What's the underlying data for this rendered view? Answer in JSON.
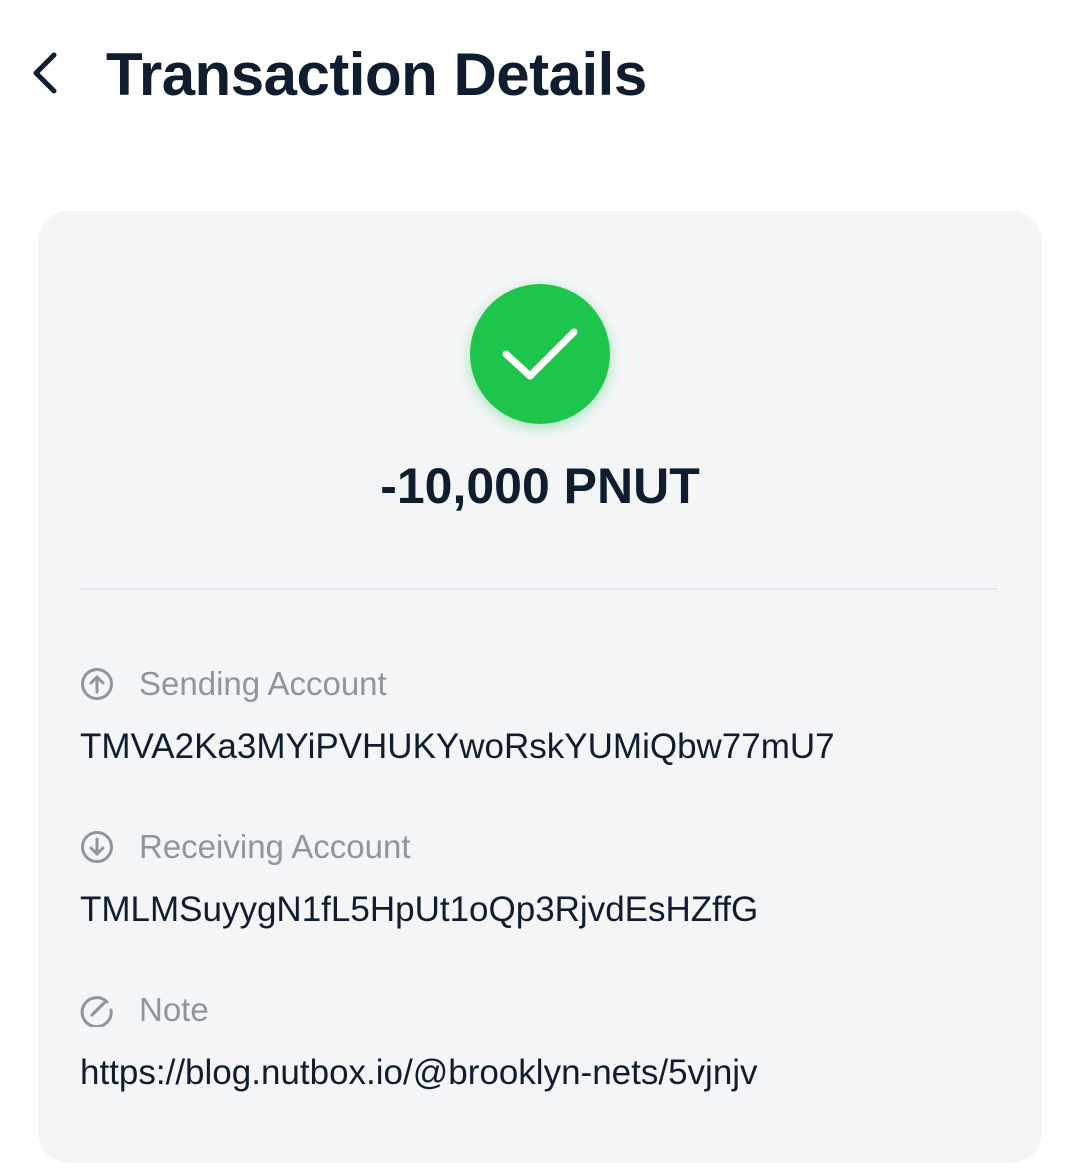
{
  "header": {
    "title": "Transaction Details",
    "back_icon": "chevron-left-icon"
  },
  "transaction": {
    "status_icon": "check-circle-icon",
    "status_color": "#1dc54d",
    "amount": "-10,000 PNUT"
  },
  "fields": {
    "sending": {
      "icon": "arrow-up-circle-icon",
      "label": "Sending Account",
      "value": "TMVA2Ka3MYiPVHUKYwoRskYUMiQbw77mU7"
    },
    "receiving": {
      "icon": "arrow-down-circle-icon",
      "label": "Receiving Account",
      "value": "TMLMSuyygN1fL5HpUt1oQp3RjvdEsHZffG"
    },
    "note": {
      "icon": "edit-circle-icon",
      "label": "Note",
      "value": "https://blog.nutbox.io/@brooklyn-nets/5vjnjv"
    }
  }
}
